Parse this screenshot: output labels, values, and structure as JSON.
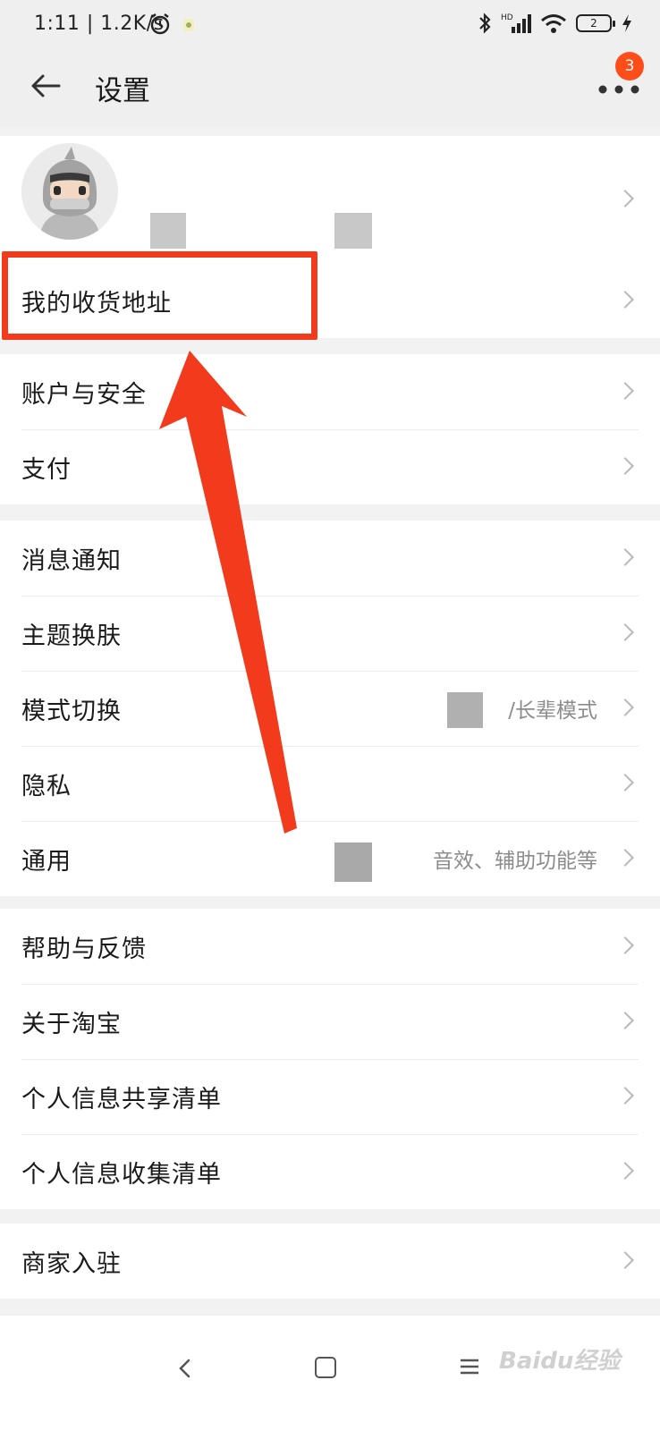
{
  "status_bar": {
    "time": "1:11 | 1.2K/s",
    "battery": "2"
  },
  "header": {
    "title": "设置",
    "badge_count": "3"
  },
  "groups": [
    {
      "items": [
        {
          "label": "我的收货地址",
          "value": ""
        }
      ]
    },
    {
      "items": [
        {
          "label": "账户与安全",
          "value": ""
        },
        {
          "label": "支付",
          "value": ""
        }
      ]
    },
    {
      "items": [
        {
          "label": "消息通知",
          "value": ""
        },
        {
          "label": "主题换肤",
          "value": ""
        },
        {
          "label": "模式切换",
          "value": "/长辈模式"
        },
        {
          "label": "隐私",
          "value": ""
        },
        {
          "label": "通用",
          "value": "音效、辅助功能等"
        }
      ]
    },
    {
      "items": [
        {
          "label": "帮助与反馈",
          "value": ""
        },
        {
          "label": "关于淘宝",
          "value": ""
        },
        {
          "label": "个人信息共享清单",
          "value": ""
        },
        {
          "label": "个人信息收集清单",
          "value": ""
        }
      ]
    },
    {
      "items": [
        {
          "label": "商家入驻",
          "value": ""
        }
      ]
    }
  ],
  "watermark": "Baidu经验",
  "colors": {
    "accent_red": "#f23b1c",
    "badge": "#ff4d1a",
    "background": "#f2f2f2"
  },
  "icons": [
    "back-arrow-icon",
    "more-dots-icon",
    "chevron-right-icon",
    "alarm-icon",
    "bluetooth-icon",
    "signal-icon",
    "wifi-icon",
    "battery-icon",
    "charging-icon"
  ]
}
